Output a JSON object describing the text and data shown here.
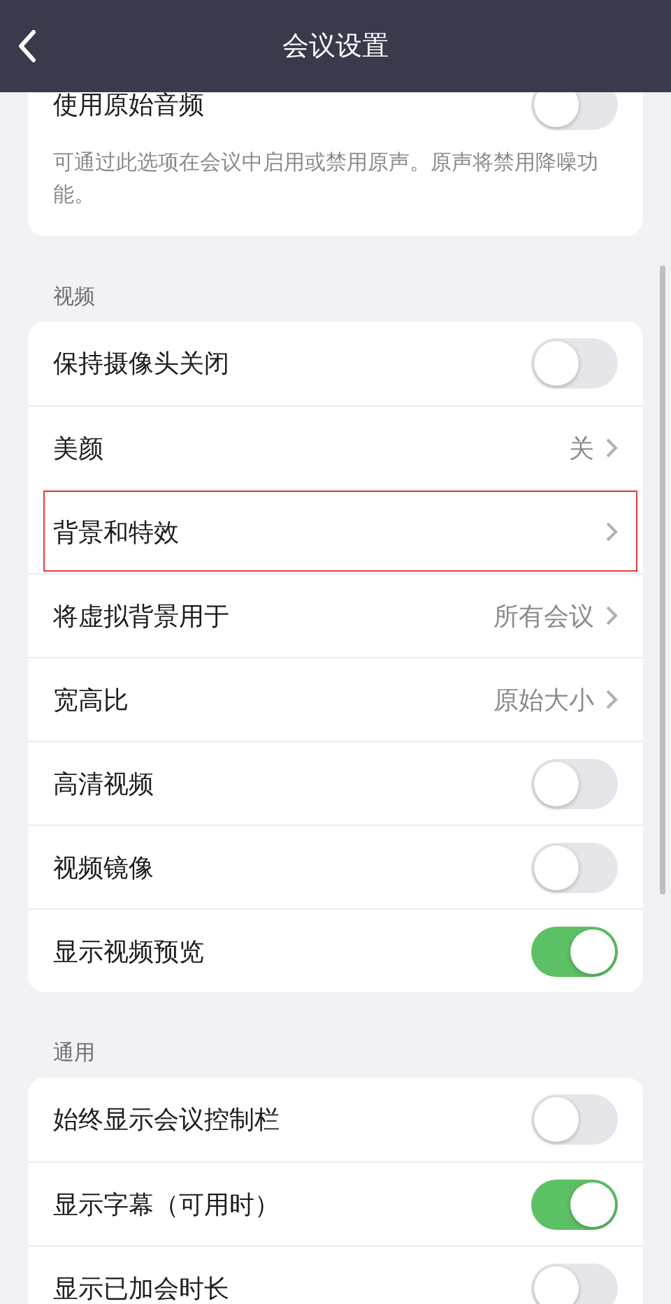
{
  "header": {
    "title": "会议设置"
  },
  "top_card": {
    "rows": [
      {
        "kind": "toggle",
        "label": "使用原始音频",
        "on": false,
        "highlighted": false
      }
    ],
    "note": "可通过此选项在会议中启用或禁用原声。原声将禁用降噪功能。"
  },
  "sections": [
    {
      "label": "视频",
      "rows": [
        {
          "kind": "toggle",
          "label": "保持摄像头关闭",
          "on": false,
          "highlighted": false
        },
        {
          "kind": "link",
          "label": "美颜",
          "value": "关",
          "highlighted": false
        },
        {
          "kind": "link",
          "label": "背景和特效",
          "highlighted": true
        },
        {
          "kind": "link",
          "label": "将虚拟背景用于",
          "value": "所有会议",
          "highlighted": false
        },
        {
          "kind": "link",
          "label": "宽高比",
          "value": "原始大小",
          "highlighted": false
        },
        {
          "kind": "toggle",
          "label": "高清视频",
          "on": false,
          "highlighted": false
        },
        {
          "kind": "toggle",
          "label": "视频镜像",
          "on": false,
          "highlighted": false
        },
        {
          "kind": "toggle",
          "label": "显示视频预览",
          "on": true,
          "highlighted": false
        }
      ]
    },
    {
      "label": "通用",
      "rows": [
        {
          "kind": "toggle",
          "label": "始终显示会议控制栏",
          "on": false,
          "highlighted": false
        },
        {
          "kind": "toggle",
          "label": "显示字幕（可用时）",
          "on": true,
          "highlighted": false
        },
        {
          "kind": "toggle",
          "label": "显示已加会时长",
          "on": false,
          "highlighted": false
        }
      ]
    }
  ]
}
